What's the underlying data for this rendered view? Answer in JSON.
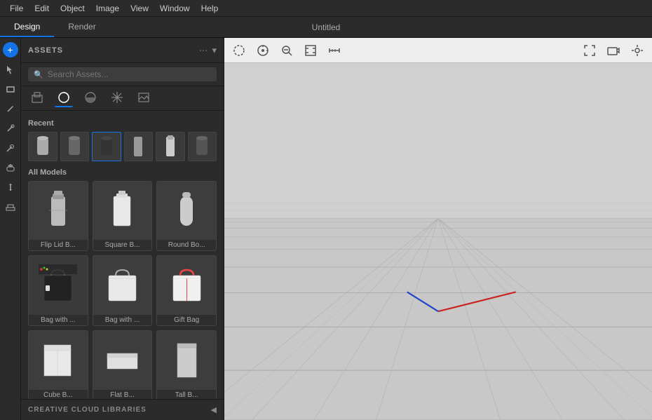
{
  "menu": {
    "items": [
      "File",
      "Edit",
      "Object",
      "Image",
      "View",
      "Window",
      "Help"
    ]
  },
  "tabs": {
    "active": "Design",
    "items": [
      "Design",
      "Render"
    ],
    "window_title": "Untitled"
  },
  "tools": {
    "items": [
      {
        "name": "add-icon",
        "symbol": "＋",
        "active": false
      },
      {
        "name": "select-icon",
        "symbol": "↖",
        "active": false
      },
      {
        "name": "rect-icon",
        "symbol": "▭",
        "active": false
      },
      {
        "name": "pen-icon",
        "symbol": "✏",
        "active": false
      },
      {
        "name": "brush-icon",
        "symbol": "✦",
        "active": false
      },
      {
        "name": "eyedropper-icon",
        "symbol": "⊘",
        "active": false
      },
      {
        "name": "hand-icon",
        "symbol": "✋",
        "active": false
      },
      {
        "name": "transform-icon",
        "symbol": "↕",
        "active": false
      },
      {
        "name": "floor-icon",
        "symbol": "⊞",
        "active": false
      }
    ]
  },
  "assets": {
    "title": "ASSETS",
    "search_placeholder": "Search Assets...",
    "categories": [
      {
        "name": "models-icon",
        "symbol": "📦",
        "active": false
      },
      {
        "name": "materials-icon",
        "symbol": "◉",
        "active": true
      },
      {
        "name": "lights-icon",
        "symbol": "◑",
        "active": false
      },
      {
        "name": "environment-icon",
        "symbol": "✤",
        "active": false
      },
      {
        "name": "images-icon",
        "symbol": "🖼",
        "active": false
      }
    ],
    "recent_label": "Recent",
    "all_models_label": "All Models",
    "recent_items": [
      {
        "name": "recent-1",
        "color": "#888"
      },
      {
        "name": "recent-2",
        "color": "#666"
      },
      {
        "name": "recent-3",
        "color": "#333"
      },
      {
        "name": "recent-4",
        "color": "#777"
      },
      {
        "name": "recent-5",
        "color": "#999"
      },
      {
        "name": "recent-6",
        "color": "#555"
      }
    ],
    "models": [
      {
        "label": "Flip Lid B...",
        "type": "bottle",
        "color": "#aaa"
      },
      {
        "label": "Square B...",
        "type": "bottle-square",
        "color": "#ddd"
      },
      {
        "label": "Round Bo...",
        "type": "bottle-round",
        "color": "#bbb"
      },
      {
        "label": "Bag with ...",
        "type": "bag-dark",
        "color": "#222"
      },
      {
        "label": "Bag with ...",
        "type": "bag-light",
        "color": "#ddd"
      },
      {
        "label": "Gift Bag",
        "type": "gift-bag",
        "color": "#e88"
      },
      {
        "label": "Cube B...",
        "type": "cube",
        "color": "#e0e0e0"
      },
      {
        "label": "Flat B...",
        "type": "flat-box",
        "color": "#ddd"
      },
      {
        "label": "Tall B...",
        "type": "tall",
        "color": "#ccc"
      }
    ]
  },
  "viewport": {
    "tools": [
      "circle-select",
      "orbit",
      "zoom-out",
      "frame",
      "measure"
    ],
    "tools_right": [
      "fullscreen",
      "camera",
      "settings"
    ]
  },
  "cc_footer": {
    "label": "CREATIVE CLOUD LIBRARIES",
    "arrow": "◀"
  }
}
